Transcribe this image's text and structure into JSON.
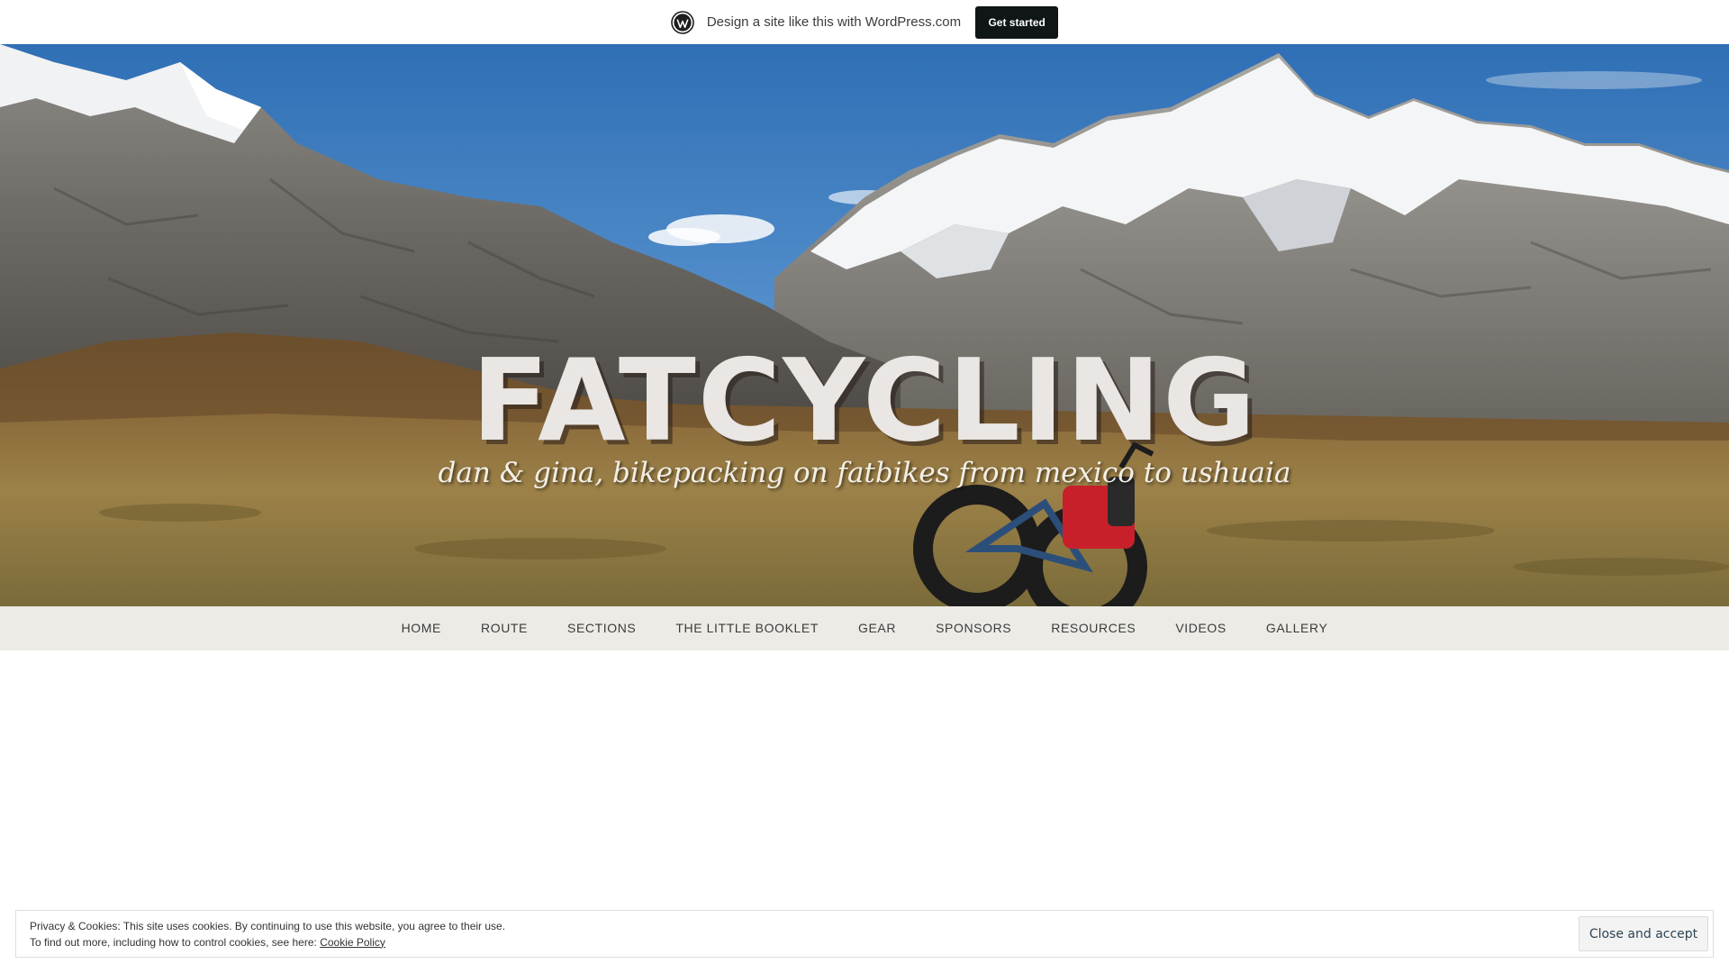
{
  "banner": {
    "text": "Design a site like this with WordPress.com",
    "cta_label": "Get started",
    "logo_icon": "wordpress-logo-icon"
  },
  "header": {
    "site_title": "FATCYCLING",
    "tagline": "dan & gina, bikepacking on fatbikes from mexico to ushuaia"
  },
  "nav": {
    "items": [
      {
        "label": "HOME"
      },
      {
        "label": "ROUTE"
      },
      {
        "label": "SECTIONS"
      },
      {
        "label": "THE LITTLE BOOKLET"
      },
      {
        "label": "GEAR"
      },
      {
        "label": "SPONSORS"
      },
      {
        "label": "RESOURCES"
      },
      {
        "label": "VIDEOS"
      },
      {
        "label": "GALLERY"
      }
    ]
  },
  "cookie": {
    "line1": "Privacy & Cookies: This site uses cookies. By continuing to use this website, you agree to their use.",
    "line2_prefix": "To find out more, including how to control cookies, see here: ",
    "policy_link": "Cookie Policy",
    "button_label": "Close and accept"
  },
  "colors": {
    "banner_button": "#101517",
    "nav_bg": "#ecebe6",
    "title": "#e9e6e4"
  }
}
